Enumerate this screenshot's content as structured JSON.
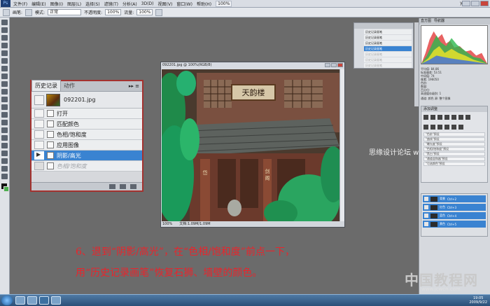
{
  "menubar": {
    "items": [
      "文件(F)",
      "编辑(E)",
      "图像(I)",
      "图层(L)",
      "选择(S)",
      "滤镜(T)",
      "分析(A)",
      "3D(D)",
      "视图(V)",
      "窗口(W)",
      "帮助(H)"
    ],
    "zoom": "100%",
    "workspace": "yyd"
  },
  "optionsbar": {
    "brush_label": "画笔:",
    "mode_label": "模式:",
    "mode_value": "正常",
    "opacity_label": "不透明度:",
    "opacity_value": "100%",
    "flow_label": "流量:",
    "flow_value": "100%"
  },
  "history_panel": {
    "tabs": [
      "历史记录",
      "动作"
    ],
    "menu_glyph": "▸▸ ≡",
    "snapshot": "092201.jpg",
    "steps": [
      {
        "label": "打开",
        "state": "normal"
      },
      {
        "label": "匹配颜色",
        "state": "normal"
      },
      {
        "label": "色相/饱和度",
        "state": "normal"
      },
      {
        "label": "应用图像",
        "state": "normal"
      },
      {
        "label": "阴影/高光",
        "state": "selected"
      },
      {
        "label": "色相/饱和度",
        "state": "dimmed"
      }
    ]
  },
  "document": {
    "title": "092201.jpg @ 100%(RGB/8)",
    "status_zoom": "100%",
    "status_doc": "文档:1.09M/1.09M",
    "plaque_text": "天韵楼",
    "couplet_left": "岱",
    "couplet_right": "剑 阁"
  },
  "mini_history": {
    "rows": [
      {
        "label": "历史记录画笔",
        "state": "normal"
      },
      {
        "label": "历史记录画笔",
        "state": "normal"
      },
      {
        "label": "历史记录画笔",
        "state": "normal"
      },
      {
        "label": "历史记录画笔",
        "state": "selected"
      },
      {
        "label": "历史记录画笔",
        "state": "dim"
      },
      {
        "label": "历史记录画笔",
        "state": "dim"
      },
      {
        "label": "历史记录画笔",
        "state": "dim"
      }
    ]
  },
  "histogram_panel": {
    "tabs": [
      "直方图",
      "导航器"
    ],
    "channel_label": "通道:",
    "channel_value": "颜色",
    "source_label": "源:",
    "source_value": "整个图像",
    "stats": [
      "平均值: 84.86",
      "标准偏差: 53.51",
      "中间值: 74",
      "像素: 196050",
      "色阶:",
      "数量:",
      "百分位:",
      "高速缓存级别: 1"
    ]
  },
  "adjustments_panel": {
    "title": "添加调整",
    "presets": [
      "\"色阶\"预设",
      "\"曲线\"预设",
      "\"曝光度\"预设",
      "\"色相/饱和度\"预设",
      "\"黑白\"预设",
      "\"通道混和器\"预设",
      "\"可选颜色\"预设"
    ]
  },
  "layers_panel": {
    "layers": [
      "背景",
      "红色",
      "蓝色",
      "黄色"
    ],
    "shortcuts": [
      "Ctrl+2",
      "Ctrl+3",
      "Ctrl+4",
      "Ctrl+5"
    ]
  },
  "watermark": "思缘设计论坛 www.MISSYUAN.COM",
  "instruction": {
    "line1": "6、退到“阴影/高光”，在“色相/饱和度”前点一下，",
    "line2": "用“历史记录画笔”恢复石狮、墙壁的颜色。"
  },
  "brand": {
    "name": "中国教程网",
    "url": "www.jcwcn.com"
  },
  "taskbar": {
    "time": "19:05",
    "date": "2009/9/22"
  },
  "colors": {
    "selected_row": "#3a83d1",
    "instruction_text": "#e8252c",
    "highlight_border": "#a4322f"
  }
}
